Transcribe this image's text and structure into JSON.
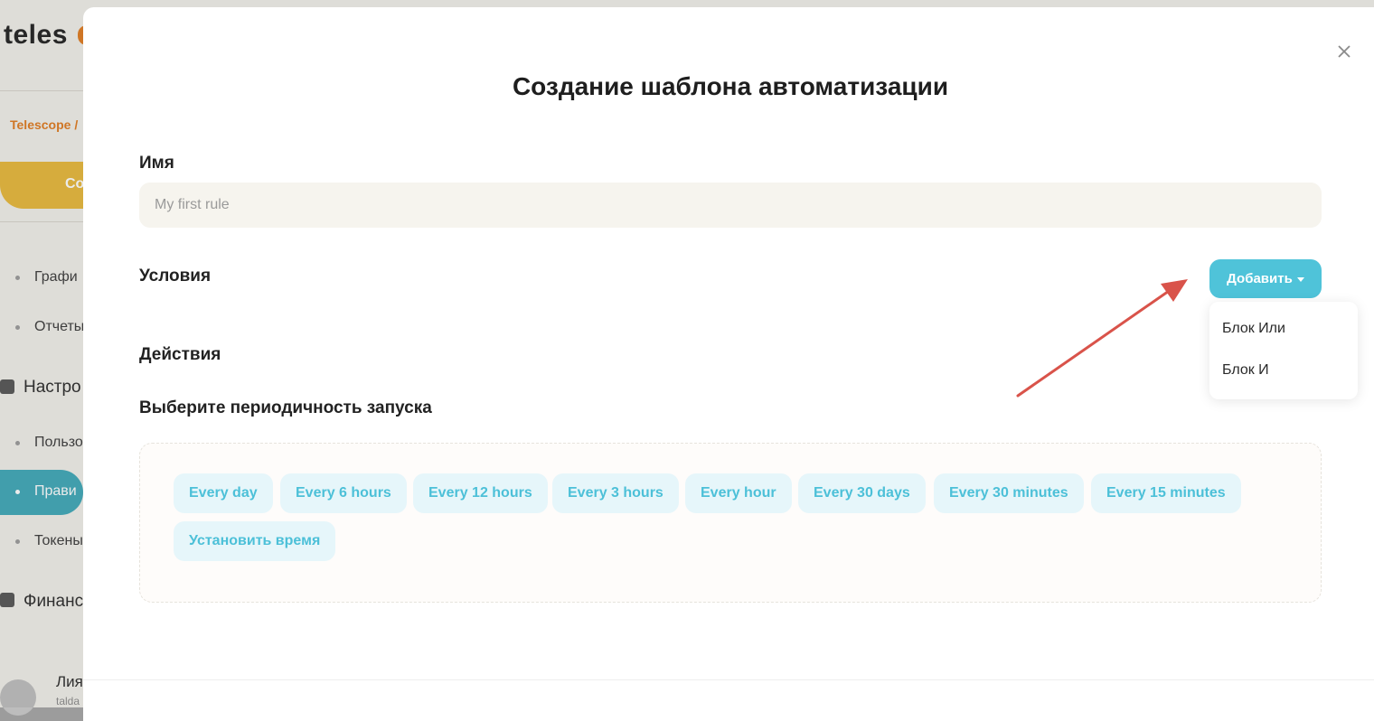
{
  "background": {
    "logo": "teles",
    "breadcrumb": "Telescope /",
    "create_button": "Со",
    "menu": {
      "graphs": "Графи",
      "reports": "Отчеты",
      "settings_section": "Настро",
      "users": "Пользо",
      "rules": "Прави",
      "tokens": "Токены",
      "finance_section": "Финанс"
    },
    "user": {
      "name": "Лия",
      "sub": "talda"
    }
  },
  "modal": {
    "title": "Создание шаблона автоматизации",
    "name_label": "Имя",
    "name_placeholder": "My first rule",
    "conditions_label": "Условия",
    "add_button": "Добавить",
    "dropdown": [
      "Блок Или",
      "Блок И"
    ],
    "actions_label": "Действия",
    "schedule_label": "Выберите периодичность запуска",
    "schedule_options": [
      "Every day",
      "Every 6 hours",
      "Every 12 hours",
      "Every 3 hours",
      "Every hour",
      "Every 30 days",
      "Every 30 minutes",
      "Every 15 minutes",
      "Установить время"
    ]
  },
  "colors": {
    "accent": "#4fc3d9",
    "chip_bg": "#e6f6fa",
    "annotation_arrow": "#d9534a",
    "brand_orange": "#e07a1e"
  },
  "icons": {
    "close": "close-icon",
    "caret": "caret-down-icon"
  }
}
